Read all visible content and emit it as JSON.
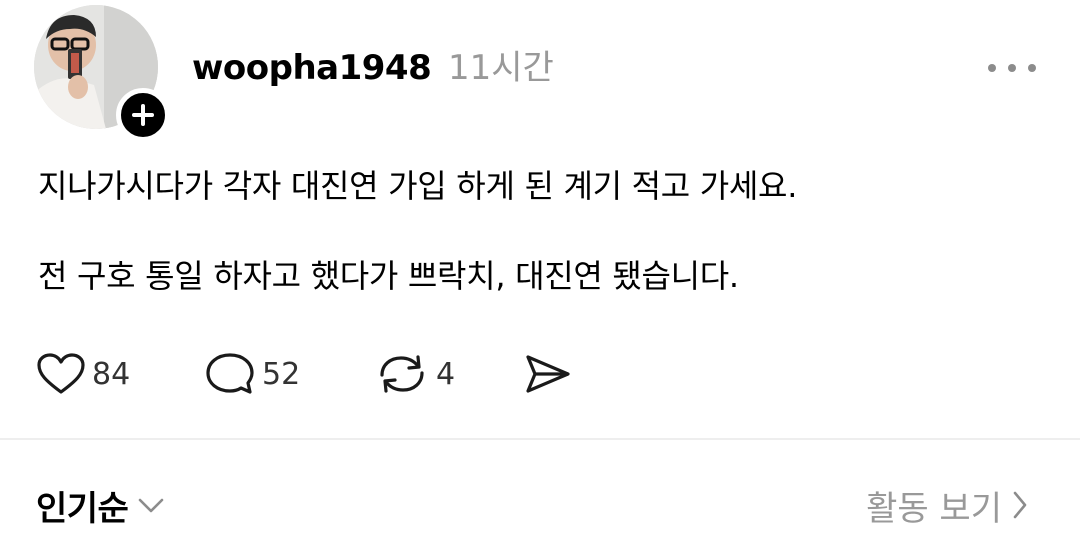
{
  "post": {
    "author": {
      "username": "woopha1948",
      "avatar_icon": "profile-photo",
      "follow_icon": "plus-icon"
    },
    "time_ago": "11시간",
    "more_icon": "more-horizontal-icon",
    "text_lines": [
      "지나가시다가 각자 대진연 가입 하게 된 계기 적고 가세요.",
      "전 구호 통일 하자고 했다가 쁘락치, 대진연 됐습니다."
    ],
    "actions": {
      "likes": "84",
      "replies": "52",
      "reposts": "4"
    }
  },
  "footer": {
    "sort_label": "인기순",
    "activity_label": "활동 보기"
  },
  "colors": {
    "text": "#000000",
    "muted": "#999999",
    "divider": "#eeeeee"
  }
}
